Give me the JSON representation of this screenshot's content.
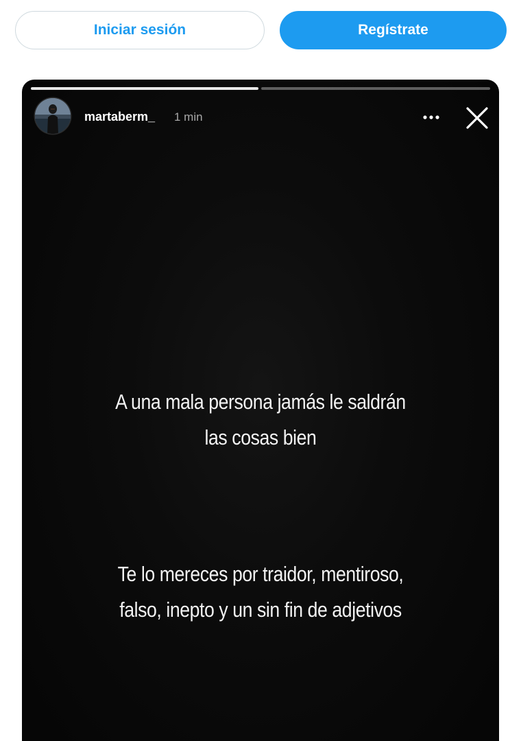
{
  "auth": {
    "login_label": "Iniciar sesión",
    "signup_label": "Regístrate"
  },
  "story": {
    "username": "martaberm_",
    "timestamp": "1 min",
    "progress": {
      "segments": 2,
      "current_segment": 2,
      "current_fill_percent": 0
    },
    "text_blocks": [
      {
        "line1": "A una mala persona jamás le saldrán",
        "line2": "las cosas bien"
      },
      {
        "line1": "Te lo mereces por traidor, mentiroso,",
        "line2": "falso, inepto y un sin fin de adjetivos"
      }
    ],
    "icons": {
      "more": "more-options-icon",
      "close": "close-icon"
    }
  },
  "colors": {
    "accent": "#1d9bf0",
    "story_background": "#0a0a0a",
    "story_text": "#f2f2f2"
  }
}
